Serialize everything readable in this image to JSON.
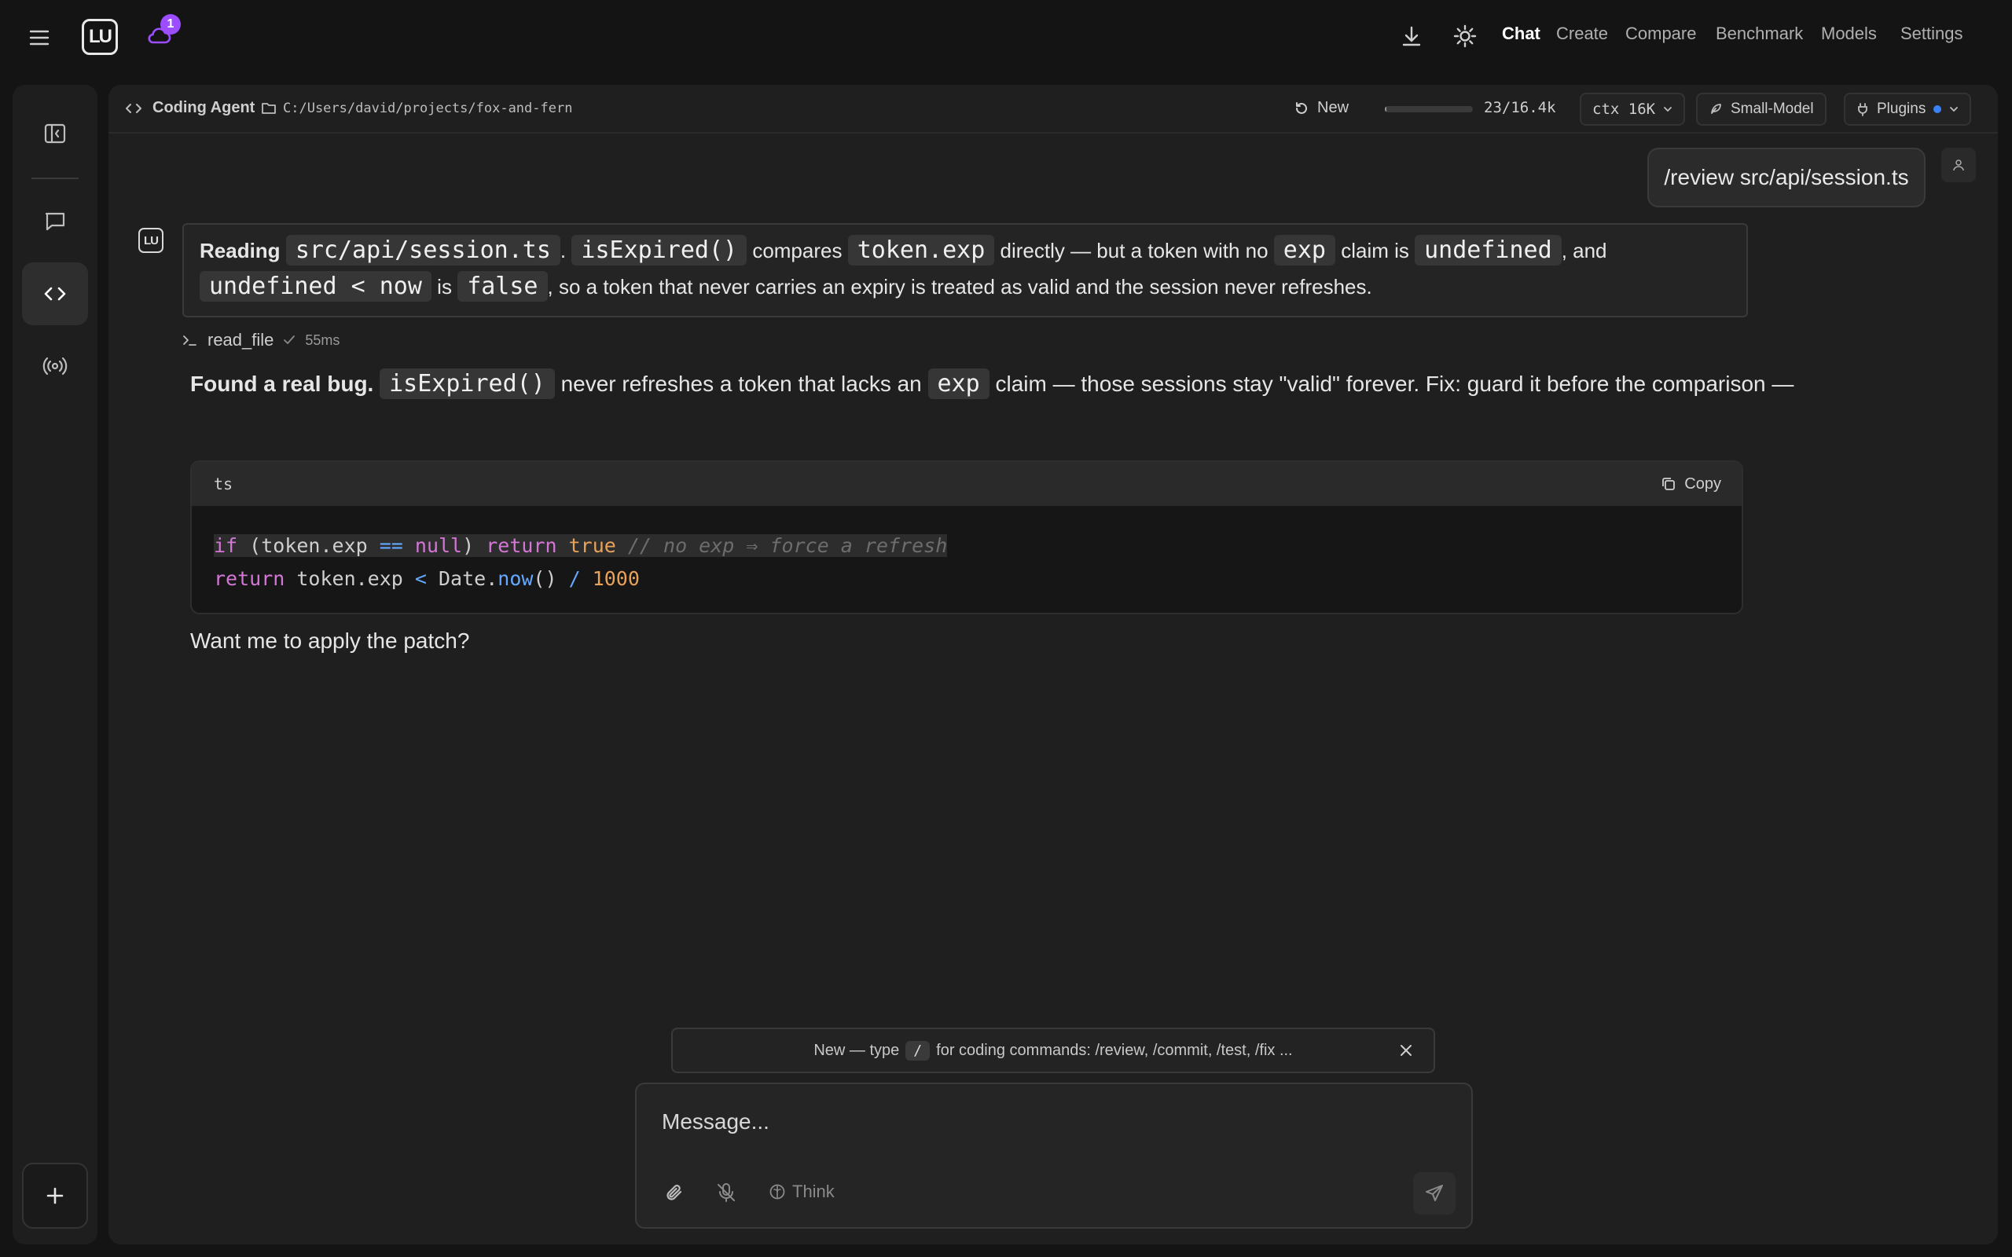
{
  "topbar": {
    "logo_text": "LU",
    "notification_count": "1",
    "nav": [
      {
        "label": "Chat",
        "active": true
      },
      {
        "label": "Create"
      },
      {
        "label": "Compare"
      },
      {
        "label": "Benchmark"
      },
      {
        "label": "Models"
      },
      {
        "label": "Settings"
      }
    ],
    "icons": [
      "hamburger-icon",
      "cloud-icon",
      "download-icon",
      "sun-icon"
    ]
  },
  "rail": {
    "icons": [
      "sidebar-toggle-icon",
      "chat-icon",
      "code-icon",
      "broadcast-icon",
      "plus-icon"
    ]
  },
  "header": {
    "agent_label": "Coding Agent",
    "path": "C:/Users/david/projects/fox-and-fern",
    "new_label": "New",
    "tokens": "23/16.4k",
    "token_fill_fraction": 0.02,
    "ctx_label": "ctx 16K",
    "model_label": "Small-Model",
    "plugins_label": "Plugins"
  },
  "chat": {
    "user_message": "/review src/api/session.ts",
    "reading": {
      "lead": "Reading",
      "file": "src/api/session.ts",
      "sep": ".",
      "fn": "isExpired()",
      "t1": "compares",
      "c1": "token.exp",
      "t2": "directly — but a token with no",
      "c2": "exp",
      "t3": "claim is",
      "c3": "undefined",
      "t4": ", and",
      "c4": "undefined < now",
      "t5": "is",
      "c5": "false",
      "t6": ", so a token that never carries an expiry is treated as valid and the session never refreshes."
    },
    "tool": {
      "name": "read_file",
      "time": "55ms"
    },
    "answer": {
      "bold": "Found a real bug.",
      "c1": "isExpired()",
      "t1": "never refreshes a token that lacks an",
      "c2": "exp",
      "t2": "claim — those sessions stay \"valid\" forever. Fix: guard it before the comparison —"
    },
    "code": {
      "lang": "ts",
      "copy_label": "Copy",
      "line1": {
        "kw_if": "if",
        "paren_open": " (token.exp ",
        "op_eq": "==",
        "sp": " ",
        "kw_null": "null",
        "paren_close": ") ",
        "kw_return": "return",
        "sp2": " ",
        "kw_true": "true",
        "comment": " // no exp ⇒ force a refresh"
      },
      "line2": {
        "kw_return": "return",
        "t1": " token.exp ",
        "op_lt": "<",
        "t2": " Date.",
        "fn_now": "now",
        "t3": "() ",
        "op_div": "/",
        "sp": " ",
        "num": "1000"
      }
    },
    "followup": "Want me to apply the patch?"
  },
  "hint": {
    "pre": "New — type",
    "key": "/",
    "post": "for coding commands: /review, /commit, /test, /fix ..."
  },
  "composer": {
    "placeholder": "Message...",
    "think_label": "Think"
  }
}
